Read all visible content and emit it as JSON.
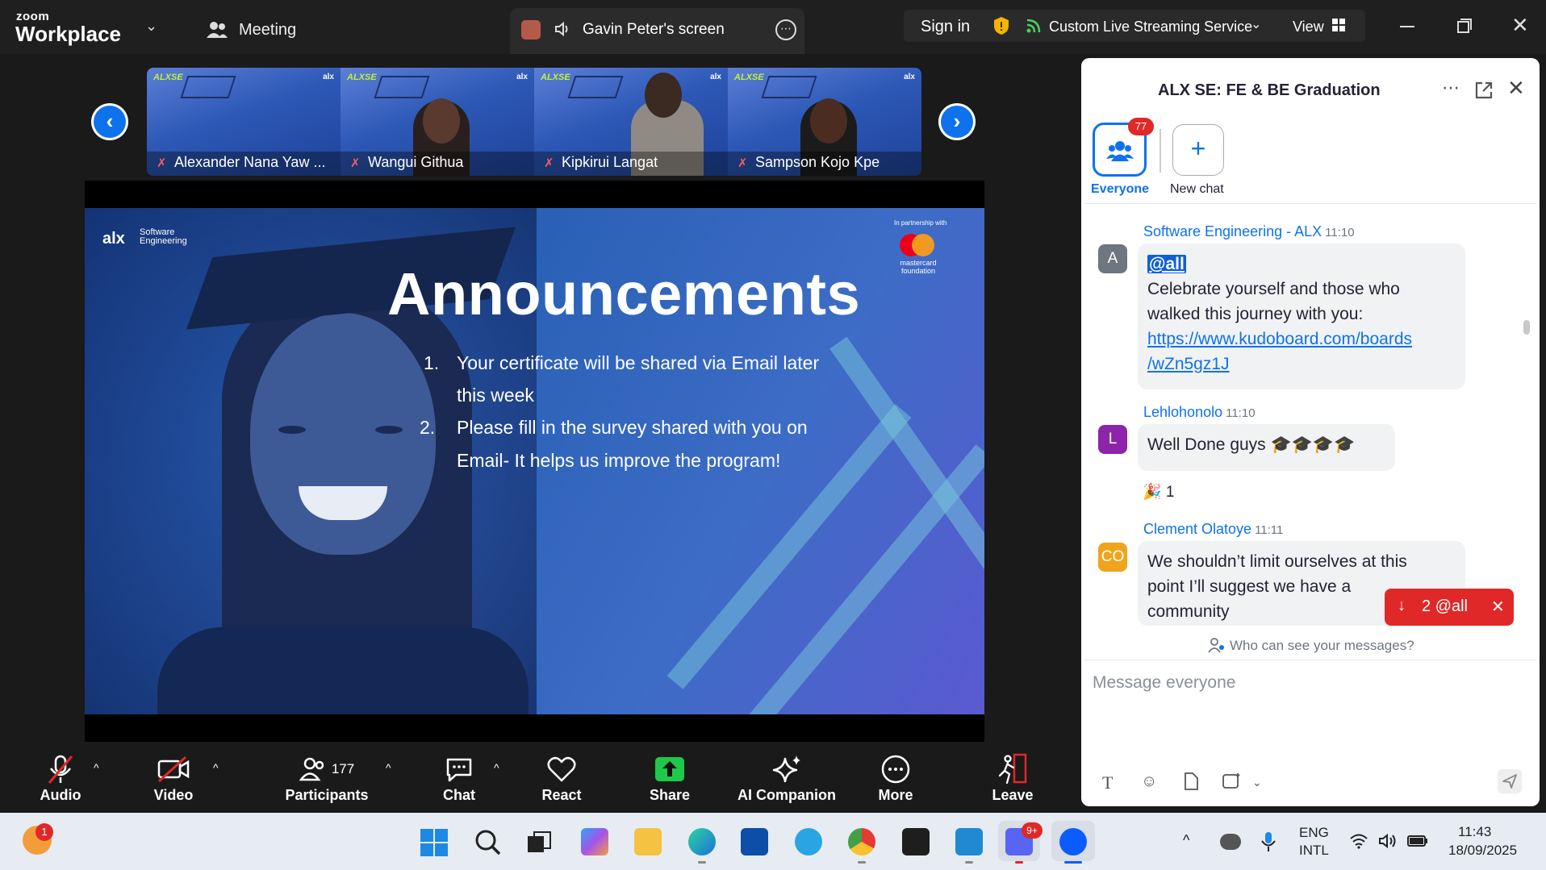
{
  "topbar": {
    "brand_small": "zoom",
    "brand_big": "Workplace",
    "meeting_label": "Meeting",
    "screen_share_label": "Gavin Peter's screen",
    "sign_in": "Sign in",
    "streaming_label": "Custom Live Streaming Service",
    "view_label": "View"
  },
  "gallery": {
    "participants": [
      {
        "name": "Alexander Nana Yaw ...",
        "logo": "ALXSE"
      },
      {
        "name": "Wangui Githua",
        "logo": "ALXSE"
      },
      {
        "name": "Kipkirui Langat",
        "logo": "ALXSE"
      },
      {
        "name": "Sampson Kojo Kpe",
        "logo": "ALXSE"
      }
    ],
    "alx_mark": "alx"
  },
  "slide": {
    "brand": "alx",
    "brand_sub_1": "Software",
    "brand_sub_2": "Engineering",
    "partner_text": "In partnership with",
    "partner_logo_1": "mastercard",
    "partner_logo_2": "foundation",
    "title": "Announcements",
    "items": [
      {
        "num": "1.",
        "line1": "Your certificate will be shared via Email later",
        "line2": "this week"
      },
      {
        "num": "2.",
        "line1": "Please fill in the survey shared with you on",
        "line2": "Email- It helps us improve the program!"
      }
    ]
  },
  "toolbar": {
    "audio": "Audio",
    "video": "Video",
    "participants": "Participants",
    "participants_count": "177",
    "chat": "Chat",
    "react": "React",
    "share": "Share",
    "ai_companion": "AI Companion",
    "more": "More",
    "leave": "Leave"
  },
  "chat": {
    "title": "ALX SE: FE & BE Graduation",
    "everyone_label": "Everyone",
    "everyone_badge": "77",
    "new_chat_label": "New chat",
    "messages": [
      {
        "initials": "A",
        "sender": "Software Engineering - ALX",
        "time": "11:10",
        "mention": "@all",
        "line1": "Celebrate yourself and those who",
        "line2": "walked this journey with you:",
        "link1": "https://www.kudoboard.com/boards",
        "link2": "/wZn5gz1J"
      },
      {
        "initials": "L",
        "sender": "Lehlohonolo",
        "time": "11:10",
        "text": "Well Done guys 🎓🎓🎓🎓",
        "reaction": "🎉 1"
      },
      {
        "initials": "CO",
        "sender": "Clement Olatoye",
        "time": "11:11",
        "line1": "We shouldn’t limit ourselves at this",
        "line2": "point I’ll suggest we have a",
        "line3": "community"
      }
    ],
    "mention_pill": "2 @all",
    "who_can_see": "Who can see your messages?",
    "input_placeholder": "Message everyone"
  },
  "taskbar": {
    "weather_badge": "1",
    "discord_badge": "9+",
    "lang_1": "ENG",
    "lang_2": "INTL",
    "time": "11:43",
    "date": "18/09/2025"
  },
  "colors": {
    "accent": "#0e72ed",
    "alert": "#e02828",
    "bar_bg": "#1a1a1a"
  }
}
